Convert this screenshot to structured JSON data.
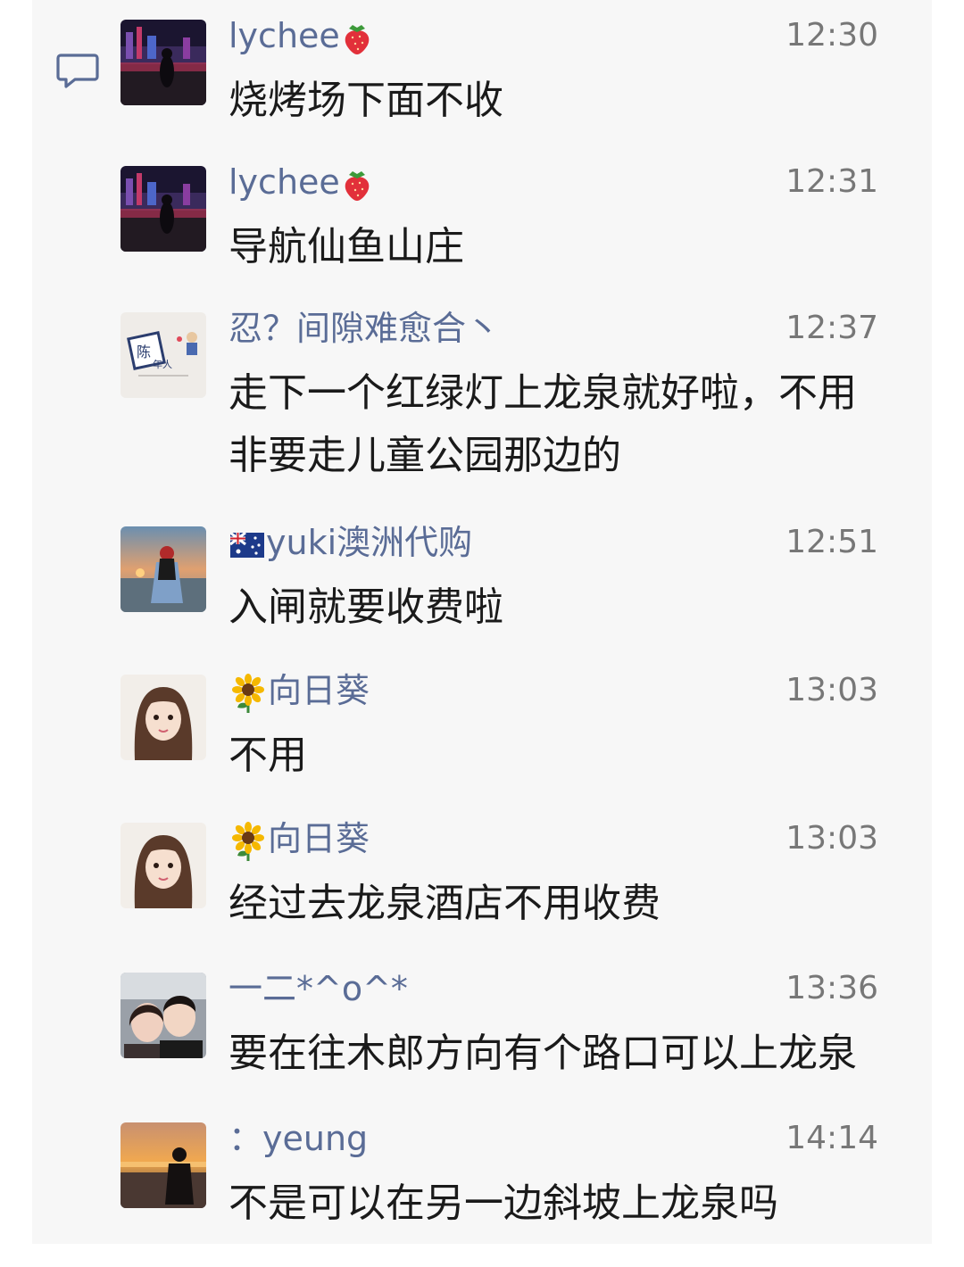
{
  "icons": {
    "comment": "comment-bubble-icon",
    "strawberry": "strawberry-icon",
    "sunflower": "sunflower-icon",
    "flag": "australia-flag-icon"
  },
  "colors": {
    "panel_bg": "#f7f7f7",
    "name": "#5a6c96",
    "time": "#777777",
    "text": "#1a1a1a"
  },
  "messages": [
    {
      "name": "lychee",
      "time": "12:30",
      "text": "烧烤场下面不收"
    },
    {
      "name": "lychee",
      "time": "12:31",
      "text": "导航仙鱼山庄"
    },
    {
      "name": "忍？间隙难愈合丶",
      "time": "12:37",
      "text": "走下一个红绿灯上龙泉就好啦，不用非要走儿童公园那边的"
    },
    {
      "name": "yuki澳洲代购",
      "time": "12:51",
      "text": "入闸就要收费啦"
    },
    {
      "name": "向日葵",
      "time": "13:03",
      "text": "不用"
    },
    {
      "name": "向日葵",
      "time": "13:03",
      "text": "经过去龙泉酒店不用收费"
    },
    {
      "name": "一二*^o^*",
      "time": "13:36",
      "text": "要在往木郎方向有个路口可以上龙泉"
    },
    {
      "name": "：yeung",
      "time": "14:14",
      "text": "不是可以在另一边斜坡上龙泉吗"
    }
  ],
  "avatar_labels": {
    "chen_top": "陈",
    "chen_bottom": "年人"
  }
}
